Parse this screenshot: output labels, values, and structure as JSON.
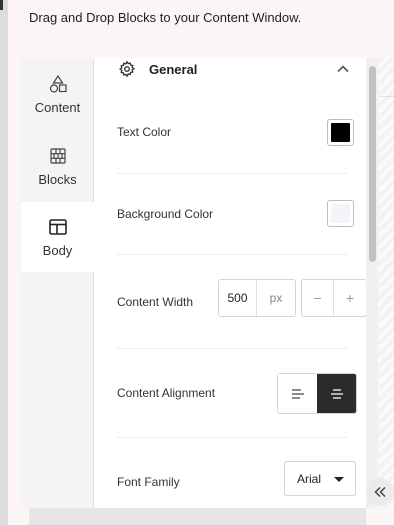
{
  "header": {
    "instruction": "Drag and Drop Blocks to your Content Window."
  },
  "tabs": [
    {
      "label": "Content",
      "icon": "shapes-icon"
    },
    {
      "label": "Blocks",
      "icon": "blocks-icon"
    },
    {
      "label": "Body",
      "icon": "layout-icon",
      "active": true
    }
  ],
  "section": {
    "title": "General",
    "icon": "gear-icon",
    "expanded": true
  },
  "settings": {
    "text_color": {
      "label": "Text Color",
      "value": "#000000"
    },
    "background_color": {
      "label": "Background Color",
      "value": "#f3f4f8"
    },
    "content_width": {
      "label": "Content Width",
      "value": "500",
      "unit": "px",
      "decrement": "−",
      "increment": "+"
    },
    "content_alignment": {
      "label": "Content Alignment",
      "options": [
        "left",
        "center"
      ],
      "selected": "center"
    },
    "font_family": {
      "label": "Font Family",
      "value": "Arial"
    }
  },
  "colors": {
    "accent_dark": "#2b2b2b",
    "panel_bg": "#fbf6f5"
  }
}
